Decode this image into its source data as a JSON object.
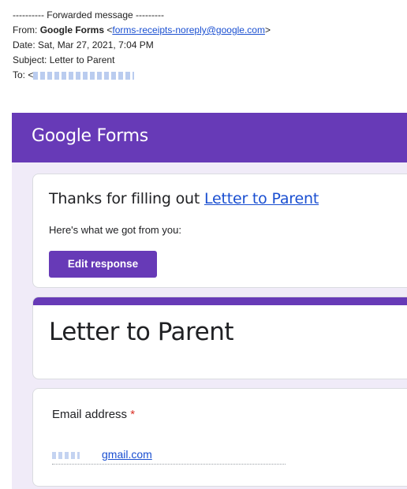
{
  "forwarded": {
    "header_line": "---------- Forwarded message ---------",
    "from_label": "From:",
    "from_name": "Google Forms",
    "from_email": "forms-receipts-noreply@google.com",
    "date_line": "Date: Sat, Mar 27, 2021, 7:04 PM",
    "subject_line": "Subject: Letter to Parent",
    "to_label": "To: <"
  },
  "forms": {
    "logo_google": "Google",
    "logo_forms": "Forms",
    "thanks_prefix": "Thanks for filling out",
    "form_link": "Letter to Parent",
    "got_text": "Here's what we got from you:",
    "edit_button": "Edit response",
    "form_title": "Letter to Parent",
    "question_label": "Email address",
    "required_mark": "*",
    "answer_suffix": "gmail.com"
  },
  "colors": {
    "brand_purple": "#673ab7",
    "background_lavender": "#f0ebf8",
    "link_blue": "#1a4fd1",
    "required_red": "#d93025"
  }
}
